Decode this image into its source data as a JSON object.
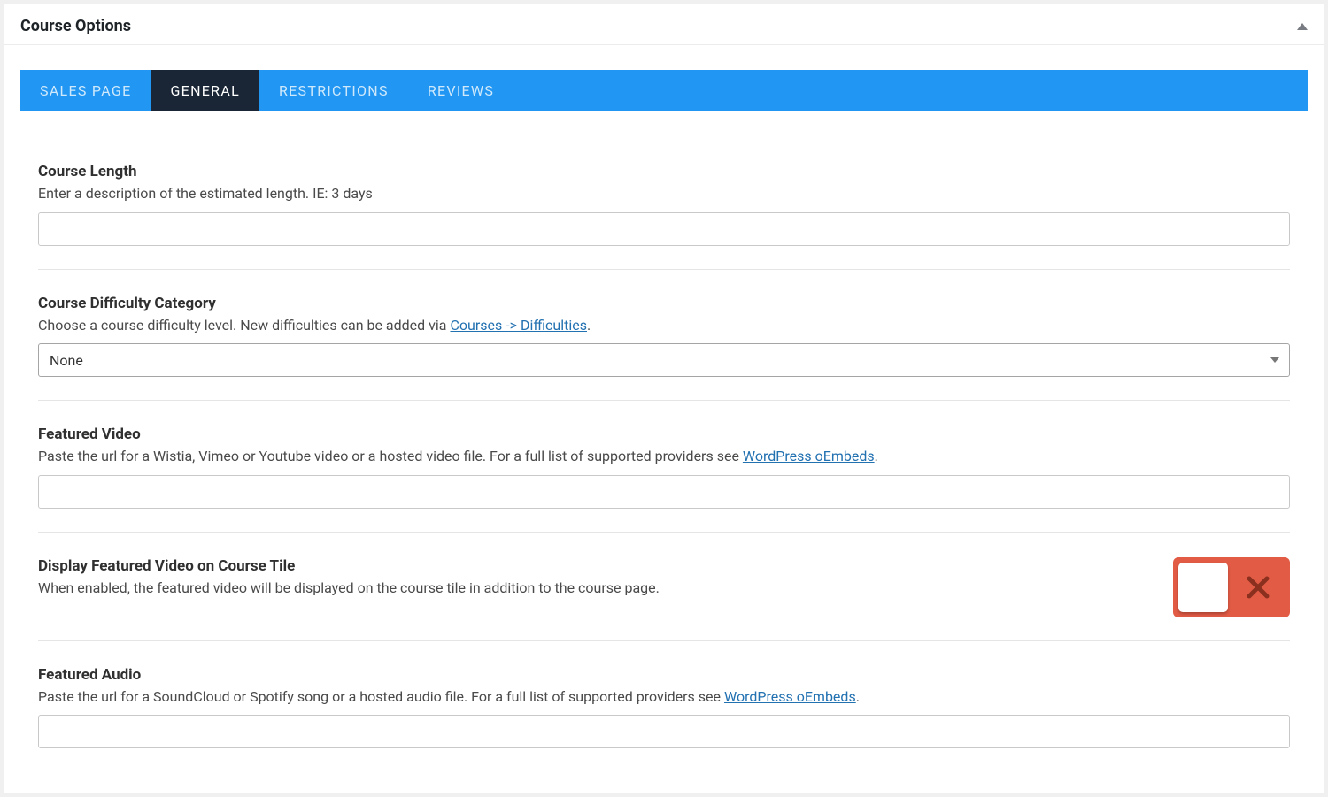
{
  "panel": {
    "title": "Course Options"
  },
  "tabs": [
    {
      "label": "SALES PAGE",
      "active": false
    },
    {
      "label": "GENERAL",
      "active": true
    },
    {
      "label": "RESTRICTIONS",
      "active": false
    },
    {
      "label": "REVIEWS",
      "active": false
    }
  ],
  "fields": {
    "course_length": {
      "label": "Course Length",
      "desc": "Enter a description of the estimated length. IE: 3 days",
      "value": ""
    },
    "difficulty": {
      "label": "Course Difficulty Category",
      "desc_pre": "Choose a course difficulty level. New difficulties can be added via ",
      "link_text": "Courses -> Difficulties",
      "desc_post": ".",
      "selected": "None"
    },
    "featured_video": {
      "label": "Featured Video",
      "desc_pre": "Paste the url for a Wistia, Vimeo or Youtube video or a hosted video file. For a full list of supported providers see ",
      "link_text": "WordPress oEmbeds",
      "desc_post": ".",
      "value": ""
    },
    "video_on_tile": {
      "label": "Display Featured Video on Course Tile",
      "desc": "When enabled, the featured video will be displayed on the course tile in addition to the course page.",
      "enabled": false
    },
    "featured_audio": {
      "label": "Featured Audio",
      "desc_pre": "Paste the url for a SoundCloud or Spotify song or a hosted audio file. For a full list of supported providers see ",
      "link_text": "WordPress oEmbeds",
      "desc_post": ".",
      "value": ""
    }
  }
}
